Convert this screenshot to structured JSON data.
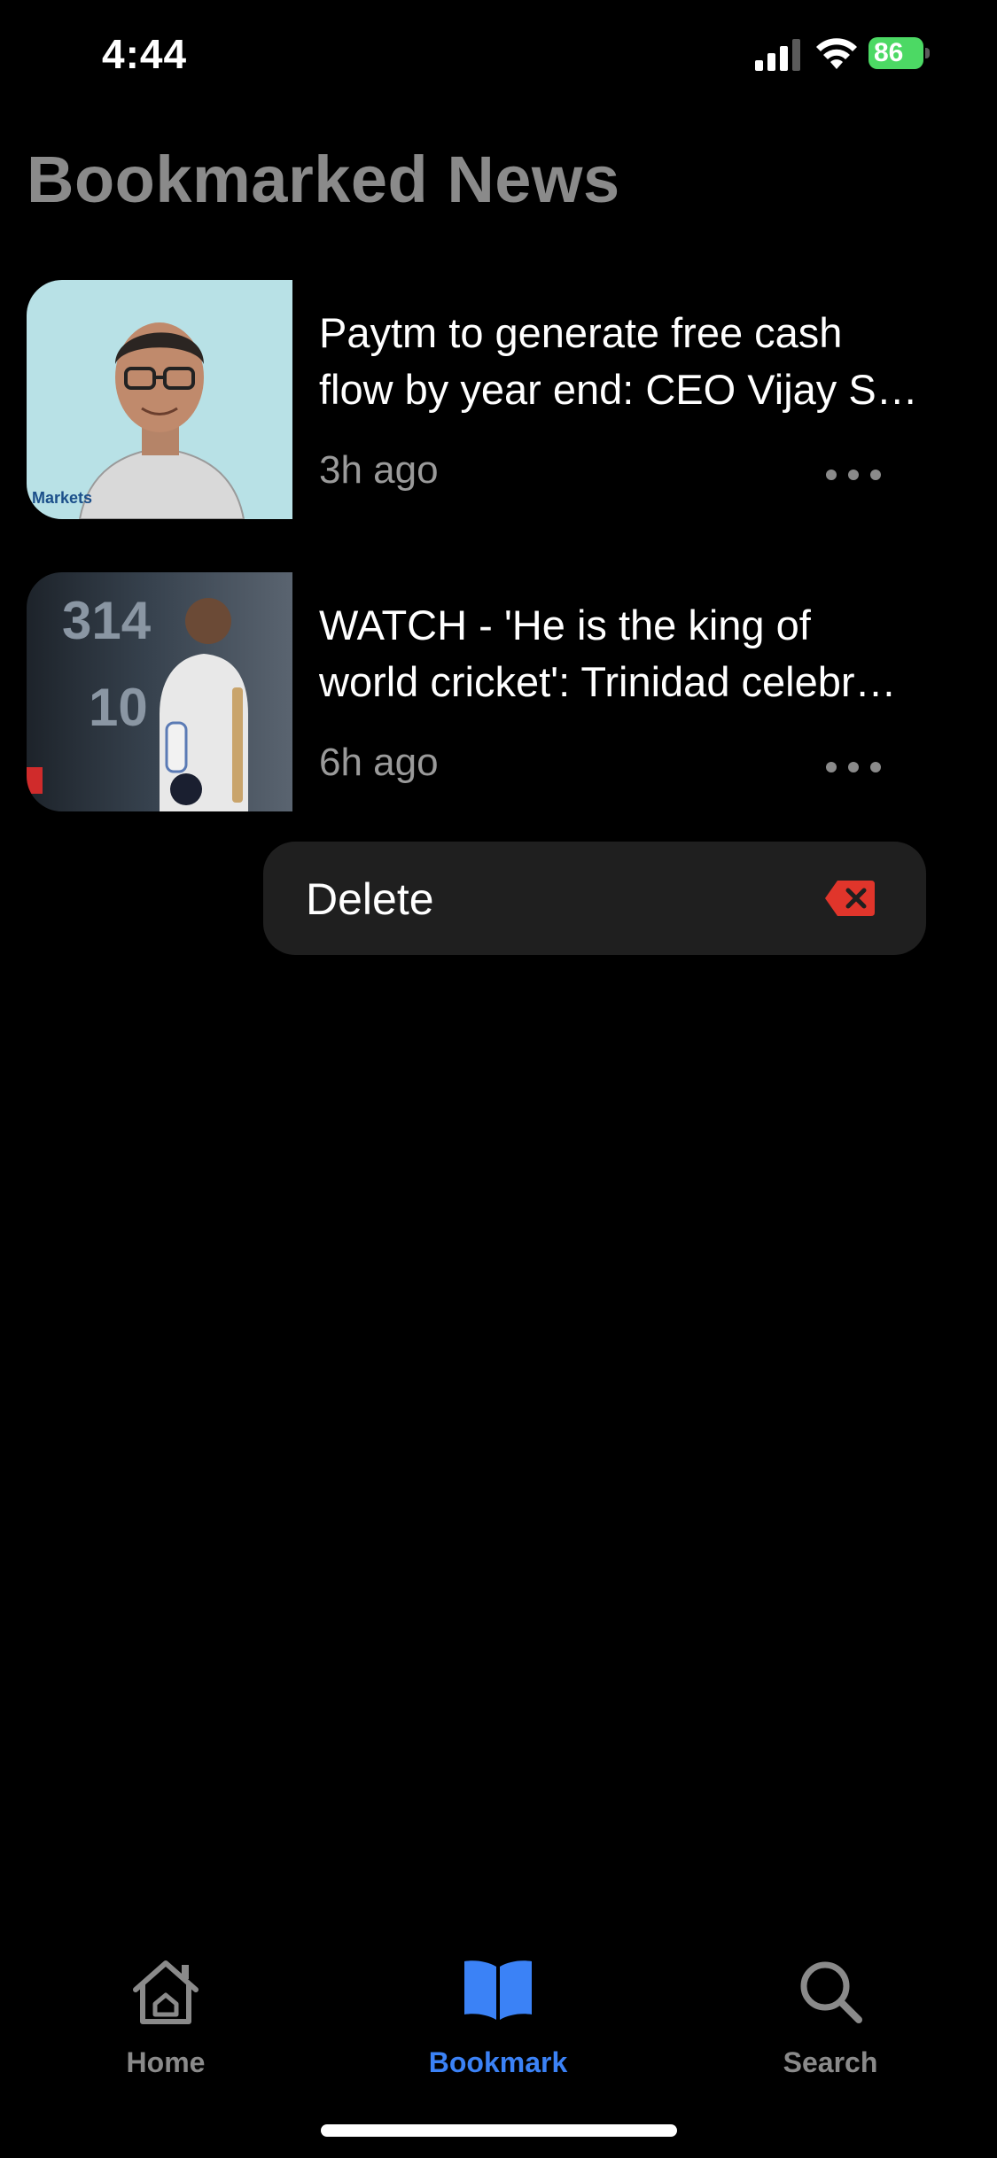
{
  "status_bar": {
    "time": "4:44",
    "battery": "86"
  },
  "header": {
    "title": "Bookmarked News"
  },
  "articles": [
    {
      "title_line1": "Paytm to generate free cash",
      "title_line2": "flow by year end: CEO Vijay S…",
      "time": "3h ago",
      "thumb_caption": "Markets"
    },
    {
      "title_line1": "WATCH - 'He is the king of",
      "title_line2": "world cricket': Trinidad celebr…",
      "time": "6h ago",
      "thumb_score_top": "314",
      "thumb_score_bottom": "10"
    }
  ],
  "context_menu": {
    "delete_label": "Delete",
    "accent": "#e0352b"
  },
  "tab_bar": {
    "tabs": [
      {
        "label": "Home",
        "active": false
      },
      {
        "label": "Bookmark",
        "active": true
      },
      {
        "label": "Search",
        "active": false
      }
    ],
    "active_color": "#3b82f6",
    "inactive_color": "#8a8a8a"
  }
}
